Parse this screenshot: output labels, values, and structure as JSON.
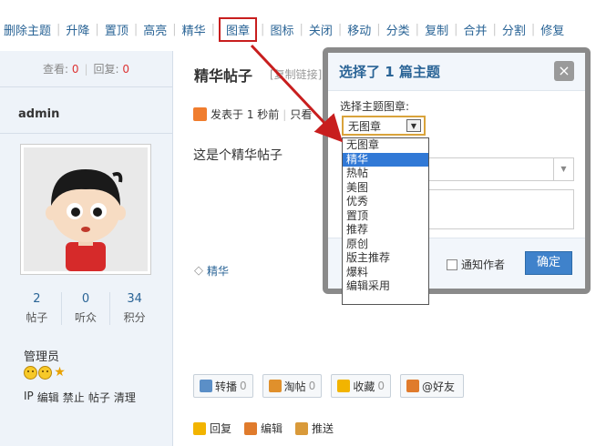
{
  "toolbar": {
    "items": [
      "删除主题",
      "升降",
      "置顶",
      "高亮",
      "精华",
      "图章",
      "图标",
      "关闭",
      "移动",
      "分类",
      "复制",
      "合并",
      "分割",
      "修复"
    ],
    "highlighted": "图章"
  },
  "sidebar": {
    "views_label": "查看:",
    "views_value": "0",
    "replies_label": "回复:",
    "replies_value": "0",
    "username": "admin",
    "counts": [
      {
        "value": "2",
        "label": "帖子"
      },
      {
        "value": "0",
        "label": "听众"
      },
      {
        "value": "34",
        "label": "积分"
      }
    ],
    "role": "管理员",
    "medal_icons": [
      "smiley-icon",
      "smiley-icon",
      "star-icon"
    ],
    "admin_links": [
      "IP",
      "编辑",
      "禁止",
      "帖子",
      "清理"
    ]
  },
  "post": {
    "title": "精华帖子",
    "copy_link": "[复制链接]",
    "meta_posted": "发表于 1 秒前",
    "meta_only": "只看",
    "body": "这是个精华帖子",
    "tag": "精华"
  },
  "actions": [
    {
      "label": "转播",
      "count": "0",
      "icon": "share-icon"
    },
    {
      "label": "淘帖",
      "count": "0",
      "icon": "collect-icon"
    },
    {
      "label": "收藏",
      "count": "0",
      "icon": "favorite-star-icon"
    },
    {
      "label": "@好友",
      "count": "",
      "icon": "friends-icon"
    }
  ],
  "bottom_links": [
    {
      "label": "回复",
      "icon": "reply-icon"
    },
    {
      "label": "编辑",
      "icon": "pencil-icon"
    },
    {
      "label": "推送",
      "icon": "push-icon"
    }
  ],
  "dialog": {
    "title": "选择了 1 篇主题",
    "close": "×",
    "label": "选择主题图章:",
    "select_value": "无图章",
    "options": [
      "无图章",
      "精华",
      "热帖",
      "美图",
      "优秀",
      "置顶",
      "推荐",
      "原创",
      "版主推荐",
      "爆料",
      "编辑采用"
    ],
    "selected_option": "精华",
    "notify_label": "通知作者",
    "confirm_label": "确定"
  },
  "colors": {
    "accent": "#2a6496",
    "highlight_border": "#c81e1e",
    "selected_option": "#3179d6",
    "confirm_button": "#3f82cb"
  }
}
